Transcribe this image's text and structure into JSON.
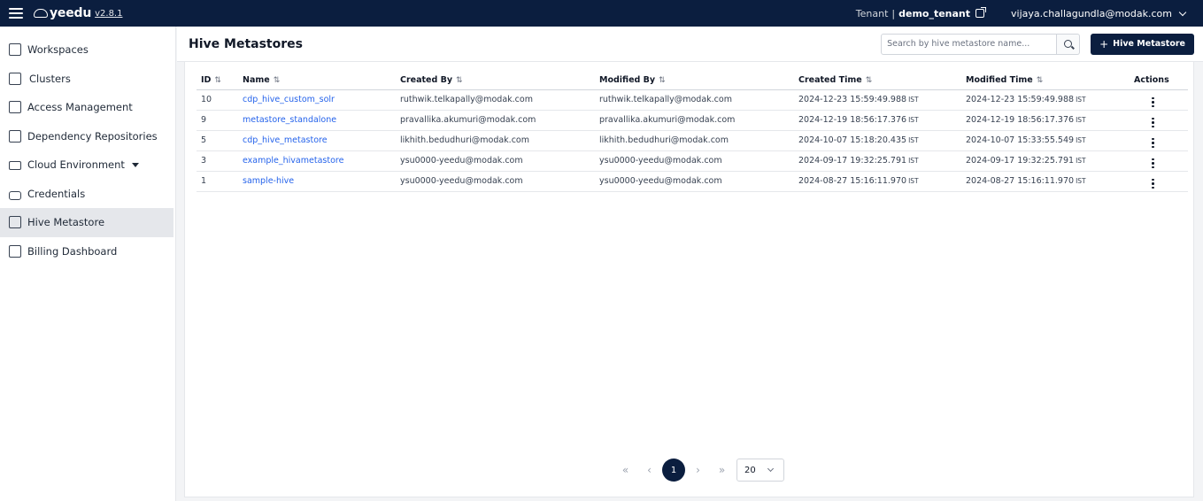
{
  "app": {
    "logo_text": "yeedu",
    "version": "v2.8.1",
    "tenant_label": "Tenant",
    "tenant_separator": "|",
    "tenant_name": "demo_tenant",
    "user_email": "vijaya.challagundla@modak.com"
  },
  "sidebar": {
    "items": [
      {
        "label": "Workspaces",
        "icon": "workspaces-icon"
      },
      {
        "label": "Clusters",
        "icon": "clusters-icon"
      },
      {
        "label": "Access Management",
        "icon": "access-management-icon"
      },
      {
        "label": "Dependency Repositories",
        "icon": "dependency-repositories-icon"
      },
      {
        "label": "Cloud Environment",
        "icon": "cloud-environment-icon"
      },
      {
        "label": "Credentials",
        "icon": "lock-icon"
      },
      {
        "label": "Hive Metastore",
        "icon": "hive-metastore-icon"
      },
      {
        "label": "Billing Dashboard",
        "icon": "billing-dashboard-icon"
      }
    ],
    "active": "Hive Metastore"
  },
  "header": {
    "title": "Hive Metastores",
    "search_placeholder": "Search by hive metastore name...",
    "add_button_label": "Hive Metastore"
  },
  "table": {
    "columns": {
      "id": "ID",
      "name": "Name",
      "created_by": "Created By",
      "modified_by": "Modified By",
      "created_time": "Created Time",
      "modified_time": "Modified Time",
      "actions": "Actions"
    },
    "rows": [
      {
        "id": "10",
        "name": "cdp_hive_custom_solr",
        "created_by": "ruthwik.telkapally@modak.com",
        "modified_by": "ruthwik.telkapally@modak.com",
        "created_time": "2024-12-23 15:59:49.988",
        "modified_time": "2024-12-23 15:59:49.988",
        "tz": "IST"
      },
      {
        "id": "9",
        "name": "metastore_standalone",
        "created_by": "pravallika.akumuri@modak.com",
        "modified_by": "pravallika.akumuri@modak.com",
        "created_time": "2024-12-19 18:56:17.376",
        "modified_time": "2024-12-19 18:56:17.376",
        "tz": "IST"
      },
      {
        "id": "5",
        "name": "cdp_hive_metastore",
        "created_by": "likhith.bedudhuri@modak.com",
        "modified_by": "likhith.bedudhuri@modak.com",
        "created_time": "2024-10-07 15:18:20.435",
        "modified_time": "2024-10-07 15:33:55.549",
        "tz": "IST"
      },
      {
        "id": "3",
        "name": "example_hivametastore",
        "created_by": "ysu0000-yeedu@modak.com",
        "modified_by": "ysu0000-yeedu@modak.com",
        "created_time": "2024-09-17 19:32:25.791",
        "modified_time": "2024-09-17 19:32:25.791",
        "tz": "IST"
      },
      {
        "id": "1",
        "name": "sample-hive",
        "created_by": "ysu0000-yeedu@modak.com",
        "modified_by": "ysu0000-yeedu@modak.com",
        "created_time": "2024-08-27 15:16:11.970",
        "modified_time": "2024-08-27 15:16:11.970",
        "tz": "IST"
      }
    ]
  },
  "pagination": {
    "first": "«",
    "prev": "‹",
    "current_page": "1",
    "next": "›",
    "last": "»",
    "page_size": "20"
  }
}
